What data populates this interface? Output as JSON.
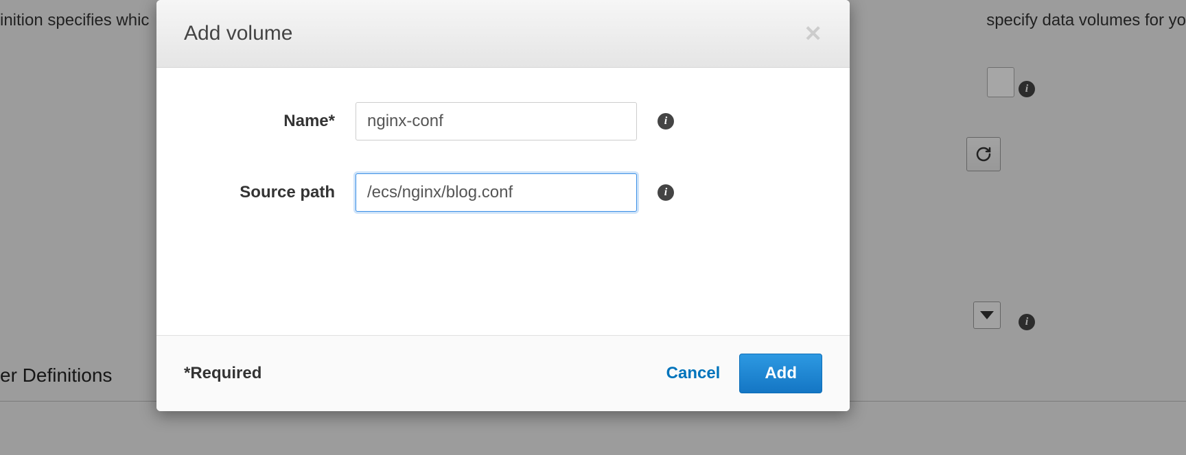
{
  "backdrop": {
    "text_top_left": "inition specifies whic",
    "text_top_right": "specify data volumes for yo",
    "section_title": "er Definitions"
  },
  "modal": {
    "title": "Add volume",
    "fields": {
      "name": {
        "label": "Name*",
        "value": "nginx-conf"
      },
      "source_path": {
        "label": "Source path",
        "value": "/ecs/nginx/blog.conf"
      }
    },
    "footer": {
      "required_note": "*Required",
      "cancel": "Cancel",
      "add": "Add"
    }
  }
}
